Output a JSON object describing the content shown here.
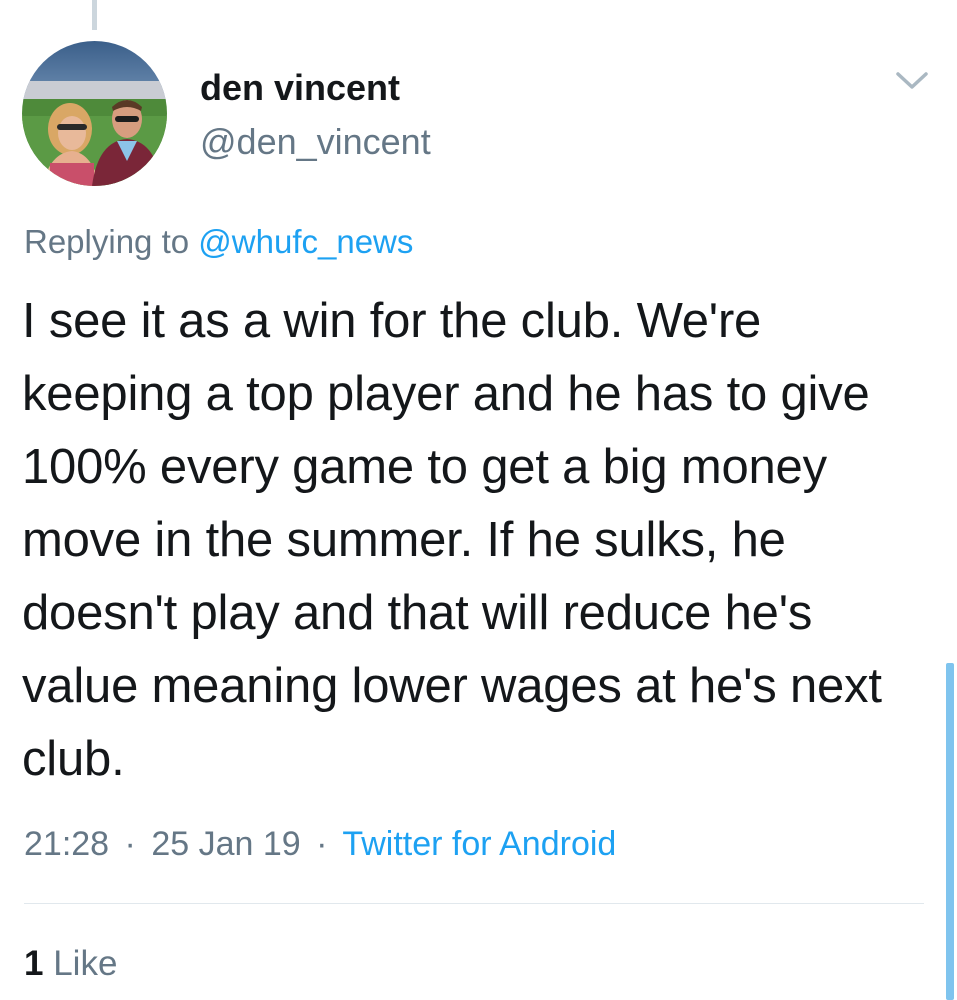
{
  "user": {
    "display_name": "den vincent",
    "handle": "@den_vincent",
    "avatar_icon": "user-avatar-photo"
  },
  "reply": {
    "prefix": "Replying to",
    "target_handle": "@whufc_news"
  },
  "tweet": {
    "text": "I see it as a win for the club. We're keeping a top player and he has to give 100% every game to get a big money move in the summer. If he sulks, he doesn't play and that will reduce he's value meaning lower wages at he's next club."
  },
  "meta": {
    "time": "21:28",
    "separator": "·",
    "date": "25 Jan 19",
    "source": "Twitter for Android"
  },
  "stats": {
    "like_count": "1",
    "like_label": "Like"
  },
  "colors": {
    "accent": "#1da1f2",
    "secondary_text": "#657786",
    "primary_text": "#14171a",
    "divider": "#e1e8ed",
    "thread_line": "#ccd6dd"
  },
  "icons": {
    "menu": "chevron-down-icon"
  }
}
